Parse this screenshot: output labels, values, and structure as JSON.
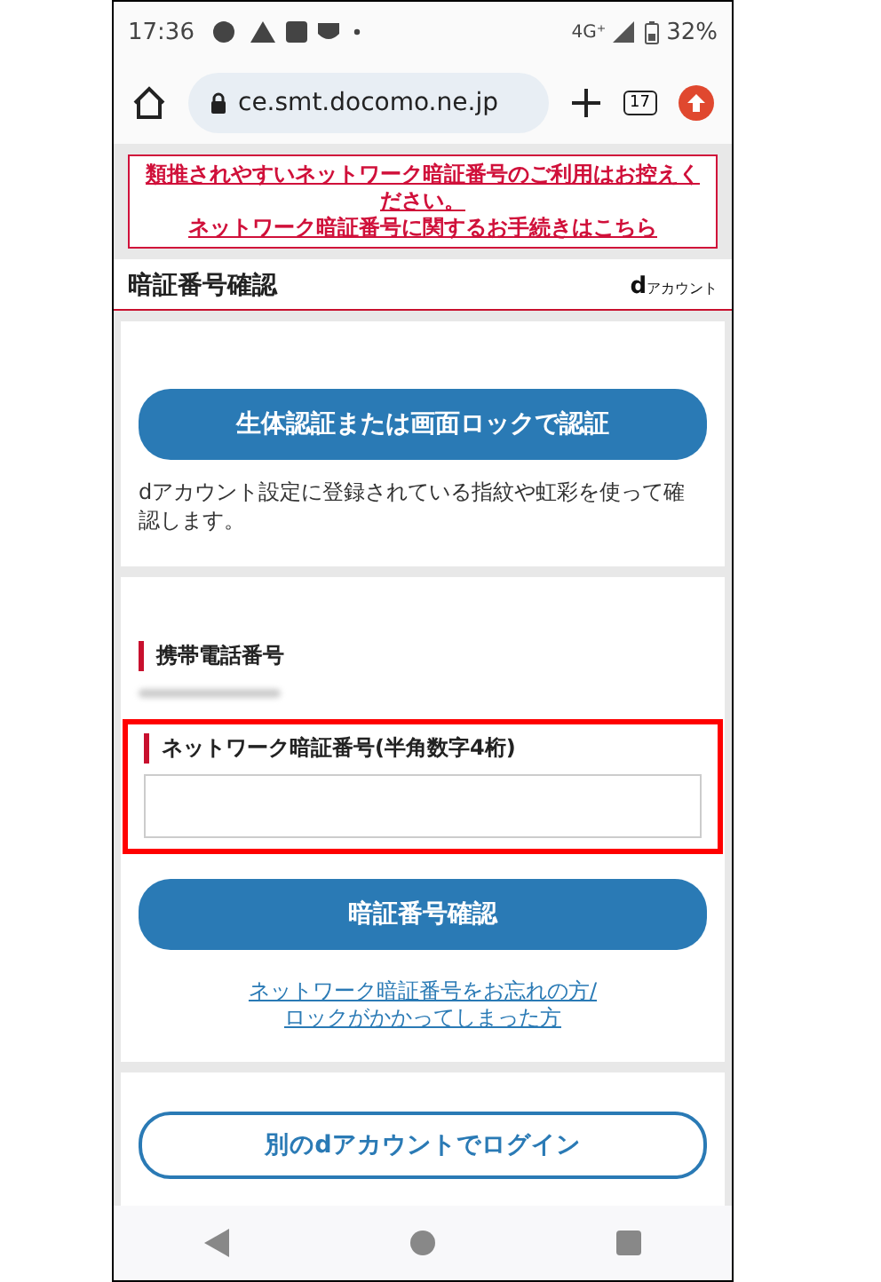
{
  "status_bar": {
    "time": "17:36",
    "network": "4G⁺",
    "battery": "32%"
  },
  "browser": {
    "url": "ce.smt.docomo.ne.jp",
    "tab_count": "17"
  },
  "notice": {
    "lines": [
      "類推されやすいネットワーク暗証番号のご利用はお控えください。",
      "ネットワーク暗証番号に関するお手続きはこちら"
    ]
  },
  "header": {
    "title": "暗証番号確認",
    "logo_mark": "d",
    "logo_text": "アカウント"
  },
  "biometric": {
    "button": "生体認証または画面ロックで認証",
    "description": "dアカウント設定に登録されている指紋や虹彩を使って確認します。"
  },
  "phone": {
    "label": "携帯電話番号",
    "blurred": true
  },
  "pin": {
    "label": "ネットワーク暗証番号(半角数字4桁)",
    "highlighted": true,
    "button": "暗証番号確認",
    "forgot_link": [
      "ネットワーク暗証番号をお忘れの方/",
      "ロックがかかってしまった方"
    ]
  },
  "other_login": {
    "button": "別のdアカウントでログイン"
  }
}
